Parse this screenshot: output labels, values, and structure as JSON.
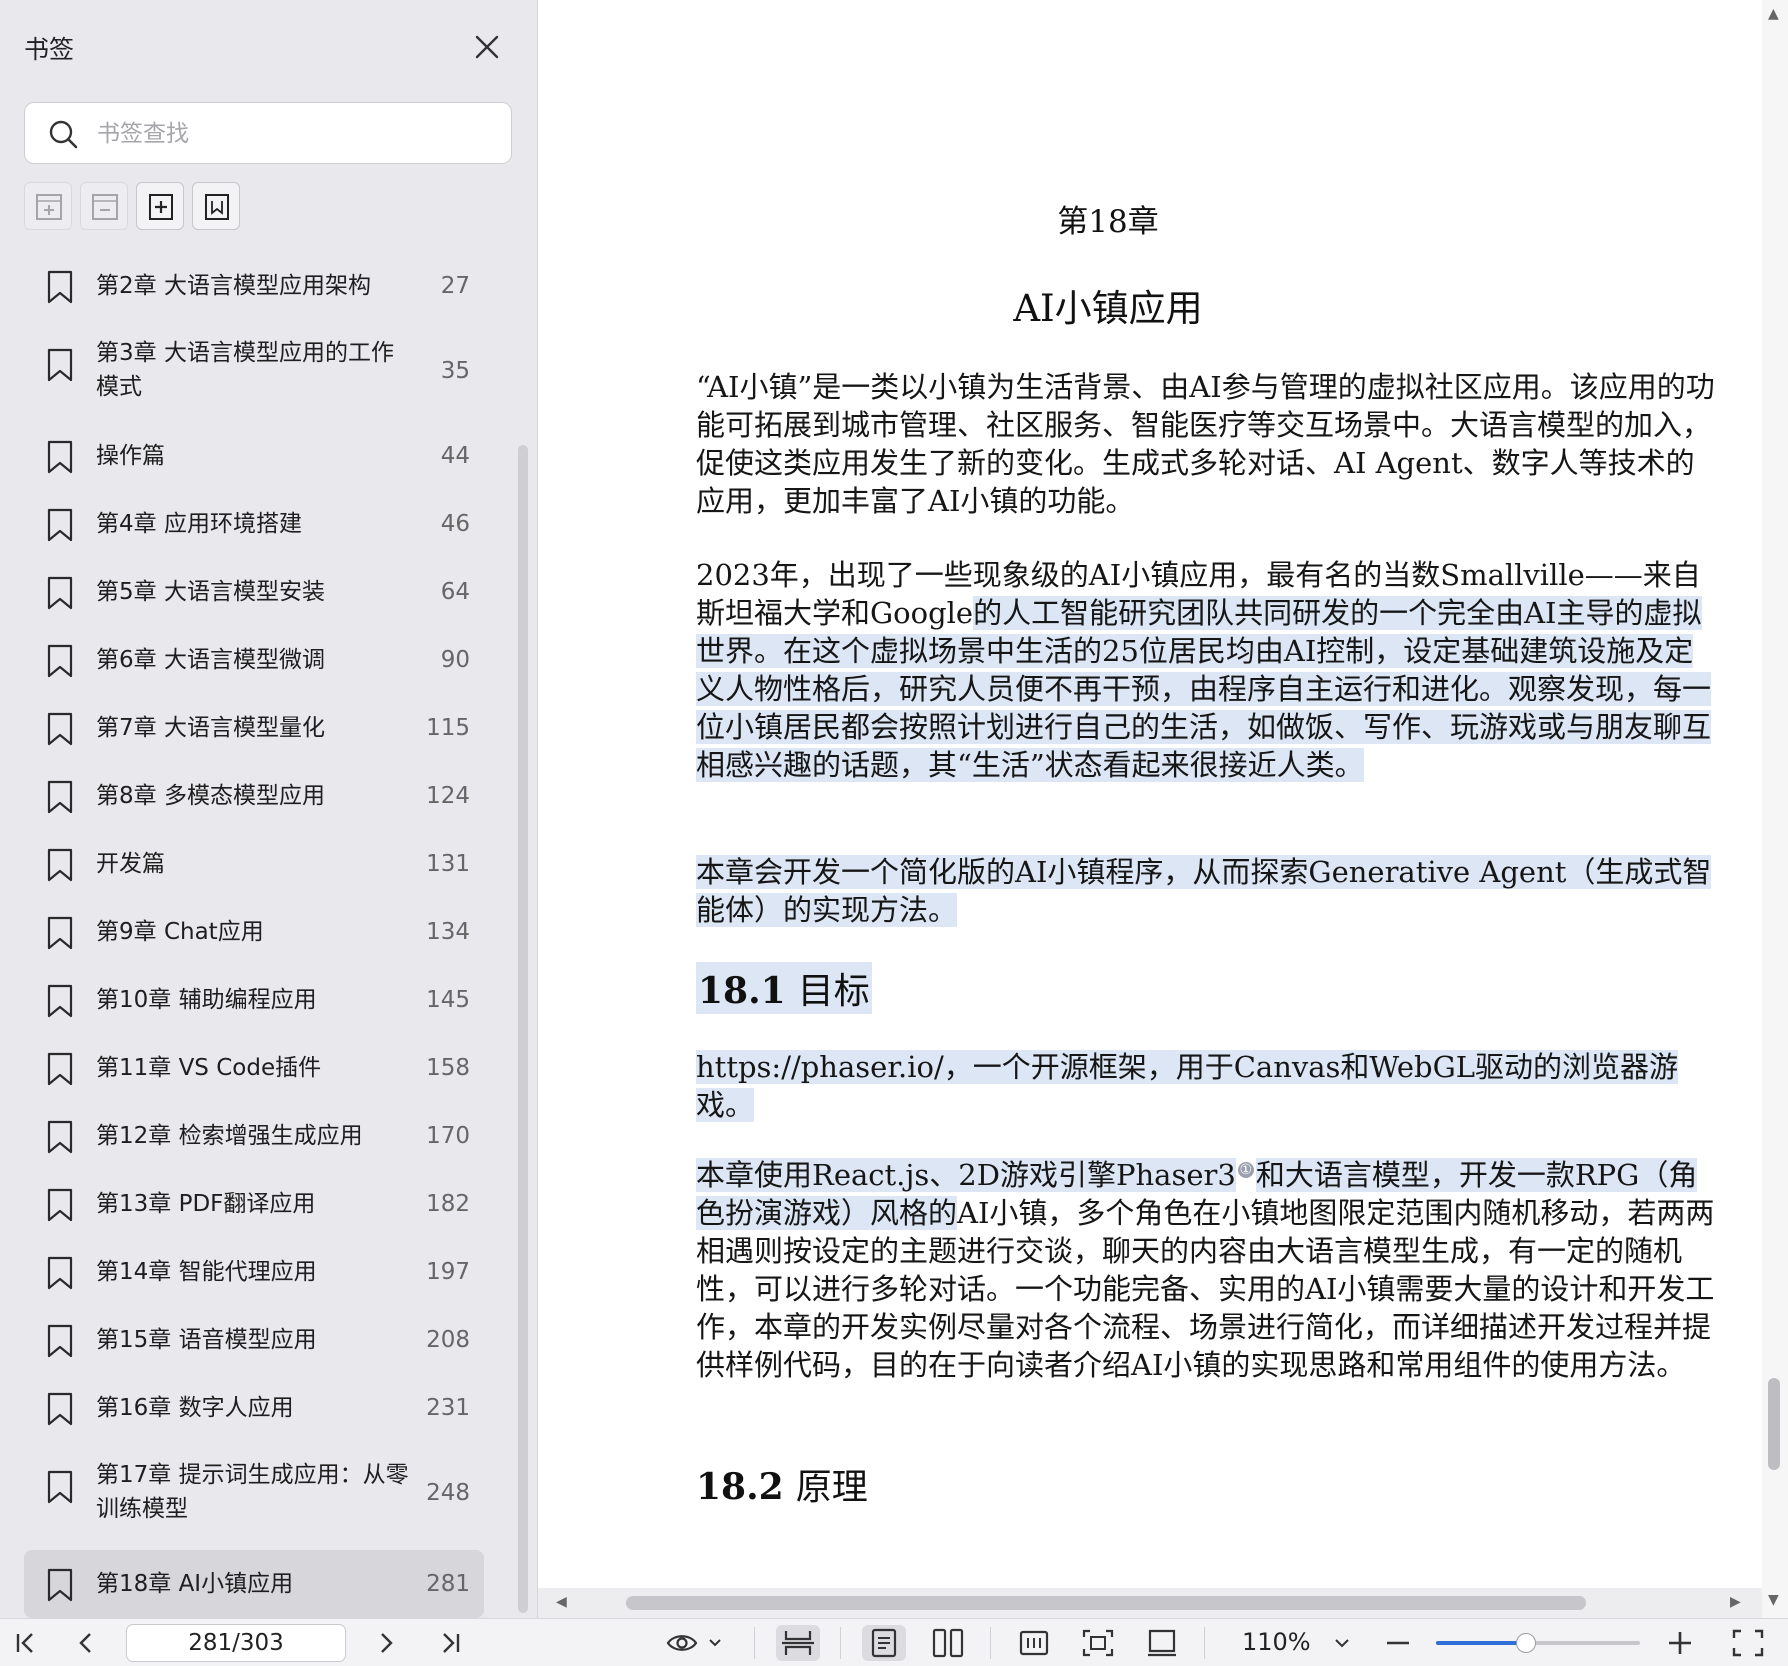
{
  "sidebar": {
    "title": "书签",
    "search_placeholder": "书签查找",
    "items": [
      {
        "label": "第2章 大语言模型应用架构",
        "page": "27"
      },
      {
        "label": "第3章 大语言模型应用的工作模式",
        "page": "35"
      },
      {
        "label": "操作篇",
        "page": "44"
      },
      {
        "label": "第4章 应用环境搭建",
        "page": "46"
      },
      {
        "label": "第5章 大语言模型安装",
        "page": "64"
      },
      {
        "label": "第6章 大语言模型微调",
        "page": "90"
      },
      {
        "label": "第7章 大语言模型量化",
        "page": "115"
      },
      {
        "label": "第8章 多模态模型应用",
        "page": "124"
      },
      {
        "label": "开发篇",
        "page": "131"
      },
      {
        "label": "第9章 Chat应用",
        "page": "134"
      },
      {
        "label": "第10章 辅助编程应用",
        "page": "145"
      },
      {
        "label": "第11章 VS Code插件",
        "page": "158"
      },
      {
        "label": "第12章 检索增强生成应用",
        "page": "170"
      },
      {
        "label": "第13章 PDF翻译应用",
        "page": "182"
      },
      {
        "label": "第14章 智能代理应用",
        "page": "197"
      },
      {
        "label": "第15章 语音模型应用",
        "page": "208"
      },
      {
        "label": "第16章 数字人应用",
        "page": "231"
      },
      {
        "label": "第17章 提示词生成应用：从零训练模型",
        "page": "248"
      },
      {
        "label": "第18章 AI小镇应用",
        "page": "281"
      }
    ],
    "active_index": 18
  },
  "document": {
    "chapter_number": "第18章",
    "chapter_title": "AI小镇应用",
    "p1": "“AI小镇”是一类以小镇为生活背景、由AI参与管理的虚拟社区应用。该应用的功能可拓展到城市管理、社区服务、智能医疗等交互场景中。大语言模型的加入，促使这类应用发生了新的变化。生成式多轮对话、AI Agent、数字人等技术的应用，更加丰富了AI小镇的功能。",
    "p2_a": "2023年，出现了一些现象级的AI小镇应用，最有名的当数Smallville——来自斯坦福大学和Google",
    "p2_b": "的人工智能研究团队共同研发的一个完全由AI主导的虚拟世界。在这个虚拟场景中生活的25位居民均由AI控制，设定基础建筑设施及定义人物性格后，研究人员便不再干预，由程序自主运行和进化。观察发现，每一位小镇居民都会按照计划进行自己的生活，如做饭、写作、玩游戏或与朋友聊互相感兴趣的话题，其“生活”状态看起来很接近人类。",
    "p3": "本章会开发一个简化版的AI小镇程序，从而探索Generative Agent（生成式智能体）的实现方法。",
    "s1_num": "18.1",
    "s1_title": "目标",
    "p4": "https://phaser.io/，一个开源框架，用于Canvas和WebGL驱动的浏览器游戏。",
    "p5_a": "本章使用React.js、2D游戏引擎Phaser3",
    "p5_note": "①",
    "p5_b": "和大语言模型，开发一款RPG（角色扮演游戏）风格的",
    "p5_c": "AI小镇，多个角色在小镇地图限定范围内随机移动，若两两相遇则按设定的主题进行交谈，聊天的内容由大语言模型生成，有一定的随机性，可以进行多轮对话。一个功能完备、实用的AI小镇需要大量的设计和开发工作，本章的开发实例尽量对各个流程、场景进行简化，而详细描述开发过程并提供样例代码，目的在于向读者介绍AI小镇的实现思路和常用组件的使用方法。",
    "s2_num": "18.2",
    "s2_title": "原理"
  },
  "toolbar": {
    "page_indicator": "281/303",
    "zoom": "110%",
    "zoom_fraction": 0.44
  },
  "colors": {
    "highlight": "#dde6f5",
    "accent": "#2f6fd6",
    "sidebar_bg": "#e9e8ed"
  }
}
